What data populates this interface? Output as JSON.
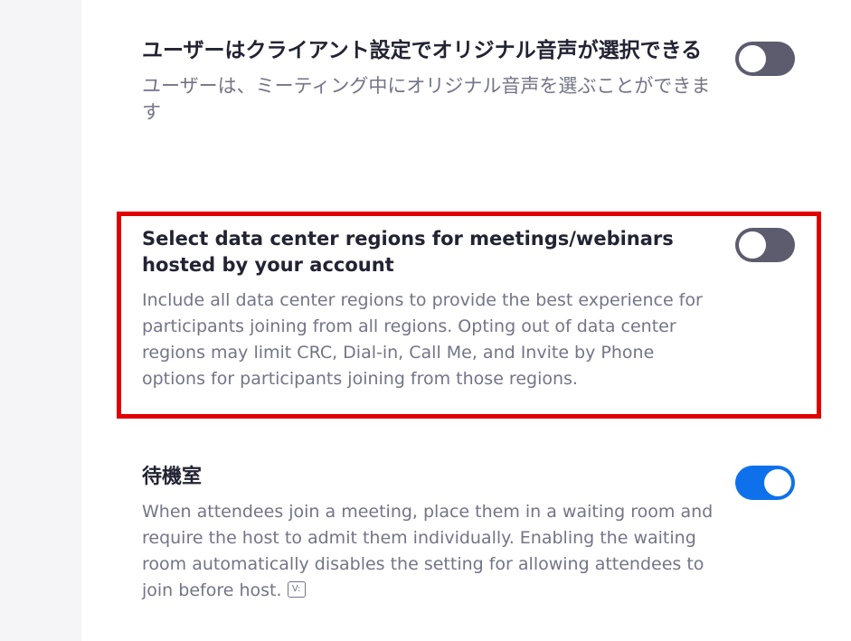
{
  "settings": [
    {
      "title": "ユーザーはクライアント設定でオリジナル音声が選択できる",
      "description": "ユーザーは、ミーティング中にオリジナル音声を選ぶことができます",
      "toggle_state": "off"
    },
    {
      "title": "Select data center regions for meetings/webinars hosted by your account",
      "description": "Include all data center regions to provide the best experience for participants joining from all regions. Opting out of data center regions may limit CRC, Dial-in, Call Me, and Invite by Phone options for participants joining from those regions.",
      "toggle_state": "off",
      "highlighted": true
    },
    {
      "title": "待機室",
      "description": "When attendees join a meeting, place them in a waiting room and require the host to admit them individually. Enabling the waiting room automatically disables the setting for allowing attendees to join before host.",
      "toggle_state": "on",
      "icon": "info-badge-icon",
      "icon_glyph": "V:"
    }
  ],
  "colors": {
    "toggle_off": "#5c5c6e",
    "toggle_on": "#0e71eb",
    "highlight_border": "#e00000",
    "title_text": "#232333",
    "description_text": "#747487",
    "left_panel": "#f5f5f7"
  }
}
